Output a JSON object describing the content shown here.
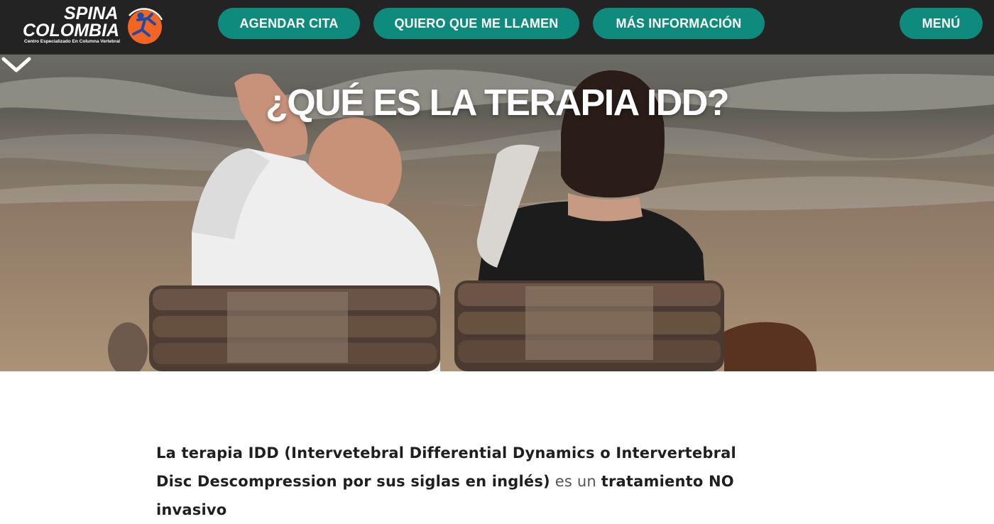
{
  "header": {
    "logo": {
      "line1": "SPINA",
      "line2": "COLOMBIA",
      "tagline": "Centro Especializado En Columna Vertebral",
      "mark_icon": "runner-spine-logo-icon",
      "mark_color": "#f26522"
    },
    "buttons": {
      "agendar": "AGENDAR CITA",
      "llamen": "QUIERO QUE ME LLAMEN",
      "info": "MÁS INFORMACIÓN",
      "menu": "MENÚ"
    },
    "accent_color": "#0f8b7e",
    "background_color": "#232323"
  },
  "hero": {
    "title": "¿QUÉ ES LA TERAPIA IDD?",
    "scroll_icon": "chevron-down-icon"
  },
  "intro": {
    "line1_bold": "La terapia IDD (Intervetebral Differential Dynamics o Intervertebral",
    "line2_bold_a": "Disc Descompression por sus siglas en inglés)",
    "line2_normal": " es un ",
    "line2_bold_b": "tratamiento NO invasivo"
  }
}
